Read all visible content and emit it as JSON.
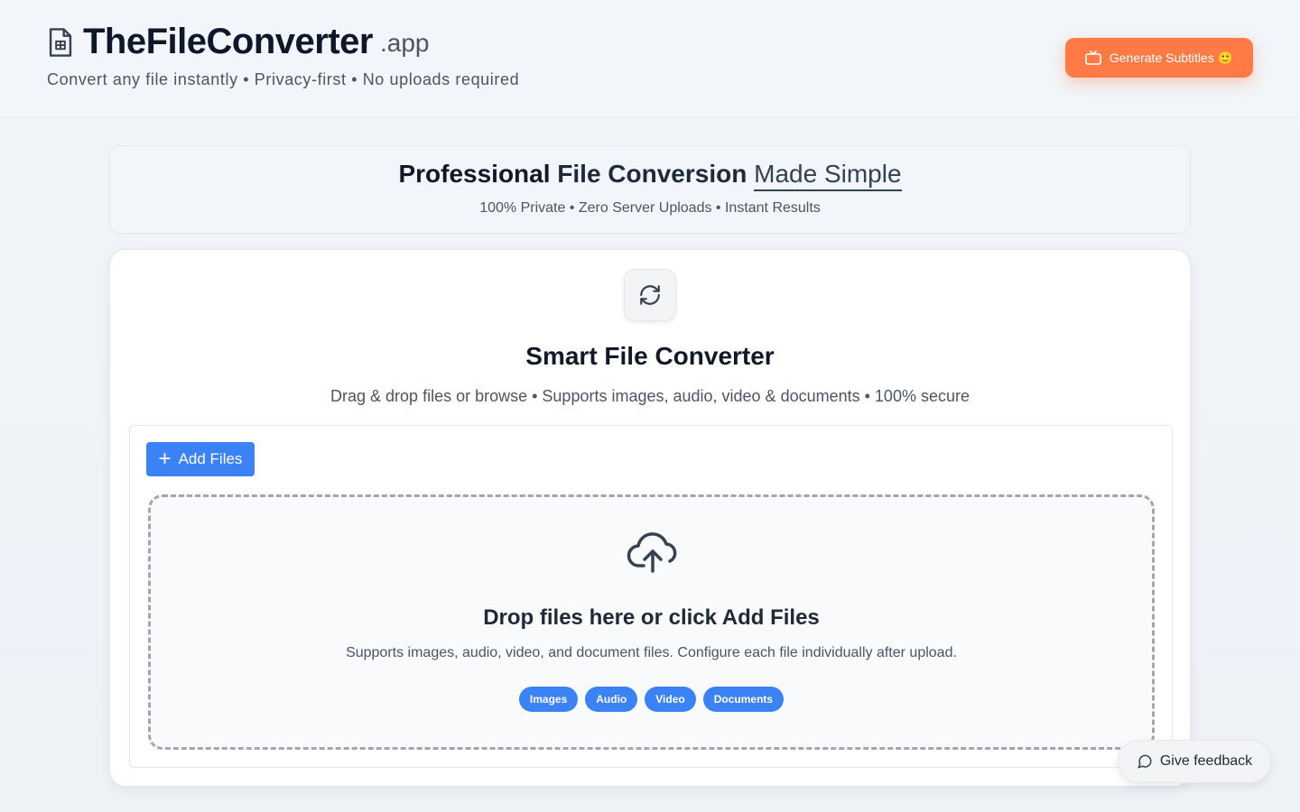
{
  "header": {
    "brand_name": "TheFileConverter",
    "brand_tld": ".app",
    "tagline": "Convert any file instantly • Privacy-first • No uploads required",
    "subtitles_button": "Generate Subtitles 🙂"
  },
  "hero": {
    "title_part1": "Professional ",
    "title_accent": "File Conversion",
    "title_part2": "Made Simple",
    "subtitle": "100% Private • Zero Server Uploads • Instant Results"
  },
  "converter": {
    "title": "Smart File Converter",
    "subtitle": "Drag & drop files or browse • Supports images, audio, video & documents • 100% secure",
    "add_files_label": "Add Files",
    "drop_title": "Drop files here or click Add Files",
    "drop_subtitle": "Supports images, audio, video, and document files. Configure each file individually after upload.",
    "tags": [
      "Images",
      "Audio",
      "Video",
      "Documents"
    ]
  },
  "feedback": {
    "label": "Give feedback"
  },
  "colors": {
    "accent_orange": "#ff7a45",
    "primary_blue": "#3b82f6"
  },
  "icons": {
    "brand": "file-spreadsheet-icon",
    "subtitles": "tv-icon",
    "converter": "refresh-icon",
    "upload": "cloud-upload-icon",
    "add": "plus-icon",
    "feedback": "message-circle-icon"
  }
}
